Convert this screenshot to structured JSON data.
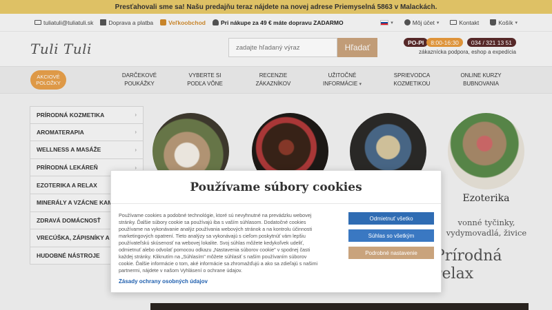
{
  "announcement": "Presťahovali sme sa! Našu predajňu teraz nájdete na novej adrese Priemyselná 5863 v Malackách.",
  "utility": {
    "email": "tuliatuli@tuliatuli.sk",
    "shipping": "Doprava a platba",
    "wholesale": "Veľkoobchod",
    "free_shipping": "Pri nákupe za 49 € máte dopravu ZADARMO",
    "account": "Môj účet",
    "contact": "Kontakt",
    "cart": "Košík"
  },
  "header": {
    "logo": "Tuli Tuli",
    "search_placeholder": "zadajte hľadaný výraz",
    "search_button": "Hľadať",
    "hours_days": "PO-PI",
    "hours_time": "8:00-16:30",
    "phone": "034 / 321 13 51",
    "contact_sub": "zákaznícka podpora, eshop a expedícia"
  },
  "nav": {
    "badge": "AKCIOVÉ POLOŽKY",
    "items": [
      "DARČEKOVÉ POUKÁŽKY",
      "VYBERTE SI PODĽA VÔNE",
      "RECENZIE ZÁKAZNÍKOV",
      "UŽITOČNÉ INFORMÁCIE",
      "SPRIEVODCA KOZMETIKOU",
      "ONLINE KURZY BUBNOVANIA"
    ]
  },
  "sidebar": [
    "PRÍRODNÁ KOZMETIKA",
    "AROMATERAPIA",
    "WELLNESS A MASÁŽE",
    "PRÍRODNÁ LEKÁREŇ",
    "EZOTERIKA A RELAX",
    "MINERÁLY A VZÁCNE KAMENE",
    "ZDRAVÁ DOMÁCNOSŤ",
    "VRECÚŠKA, ZÁPISNÍKY A TAŠKY",
    "HUDOBNÉ NÁSTROJE"
  ],
  "featured": {
    "title": "Ezoterika",
    "subtitle": "vonné tyčinky, vydymovadlá, živice"
  },
  "background_text": "Prírodná relax",
  "cookie": {
    "title": "Používame súbory cookies",
    "body": "Používame cookies a podobné technológie, ktoré sú nevyhnutné na prevádzku webovej stránky. Ďalšie súbory cookie sa používajú iba s vaším súhlasom. Dodatočné cookies používame na vykonávanie analýz používania webových stránok a na kontrolu účinnosti marketingových opatrení. Tieto analýzy sa vykonávajú s cieľom poskytnúť vám lepšiu používateľskú skúsenosť na webovej lokalite. Svoj súhlas môžete kedykoľvek udeliť, odmietnuť alebo odvolať pomocou odkazu „Nastavenia súborov cookie\" v spodnej časti každej stránky. Kliknutím na „Súhlasím\" môžete súhlasiť s naším používaním súborov cookie. Ďalšie informácie o tom, aké informácie sa zhromažďujú a ako sa zdieľajú s našimi partnermi, nájdete v našom Vyhlásení o ochrane údajov.",
    "link": "Zásady ochrany osobných údajov",
    "reject": "Odmietnuť všetko",
    "accept": "Súhlas so všetkým",
    "settings": "Podrobné nastavenie"
  },
  "colors": {
    "announce_bg": "#e8c96a",
    "accent": "#d08a2c",
    "brown_button": "#c9a37c",
    "blue_button": "#2f6cb3"
  }
}
